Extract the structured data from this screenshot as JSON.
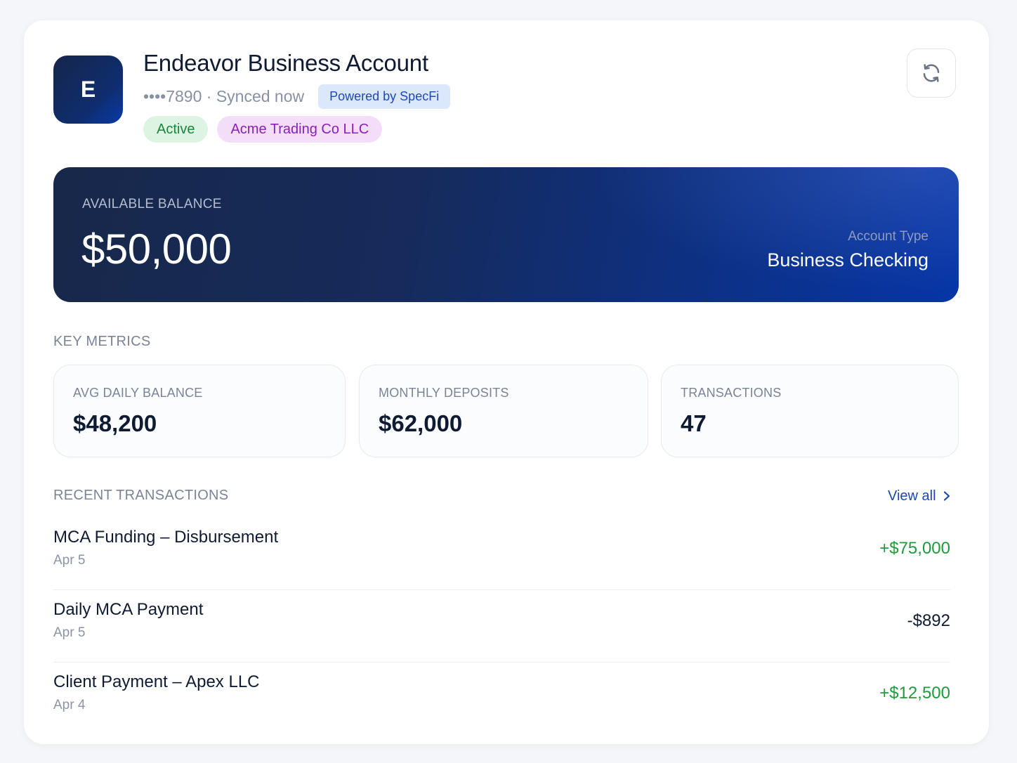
{
  "account": {
    "avatar_letter": "E",
    "title": "Endeavor Business Account",
    "meta": "••••7890 · Synced now",
    "powered_by": "Powered by SpecFi",
    "status_badge": "Active",
    "company_badge": "Acme Trading Co LLC"
  },
  "balance": {
    "label": "AVAILABLE BALANCE",
    "amount": "$50,000",
    "account_type_label": "Account Type",
    "account_type_value": "Business Checking"
  },
  "metrics": {
    "section_label": "KEY METRICS",
    "items": [
      {
        "label": "AVG DAILY BALANCE",
        "value": "$48,200"
      },
      {
        "label": "MONTHLY DEPOSITS",
        "value": "$62,000"
      },
      {
        "label": "TRANSACTIONS",
        "value": "47"
      }
    ]
  },
  "transactions": {
    "section_label": "RECENT TRANSACTIONS",
    "view_all_label": "View all",
    "items": [
      {
        "name": "MCA Funding – Disbursement",
        "date": "Apr 5",
        "amount": "+$75,000",
        "direction": "credit"
      },
      {
        "name": "Daily MCA Payment",
        "date": "Apr 5",
        "amount": "-$892",
        "direction": "debit"
      },
      {
        "name": "Client Payment – Apex LLC",
        "date": "Apr 4",
        "amount": "+$12,500",
        "direction": "credit"
      }
    ]
  },
  "colors": {
    "credit": "#1f9a3c",
    "debit": "#0f1b33",
    "accent": "#1a47b8",
    "balance_card_start": "#18284a",
    "balance_card_end": "#0635a6"
  },
  "icons": {
    "refresh": "refresh-icon",
    "view_all": "chevron-right-icon"
  }
}
